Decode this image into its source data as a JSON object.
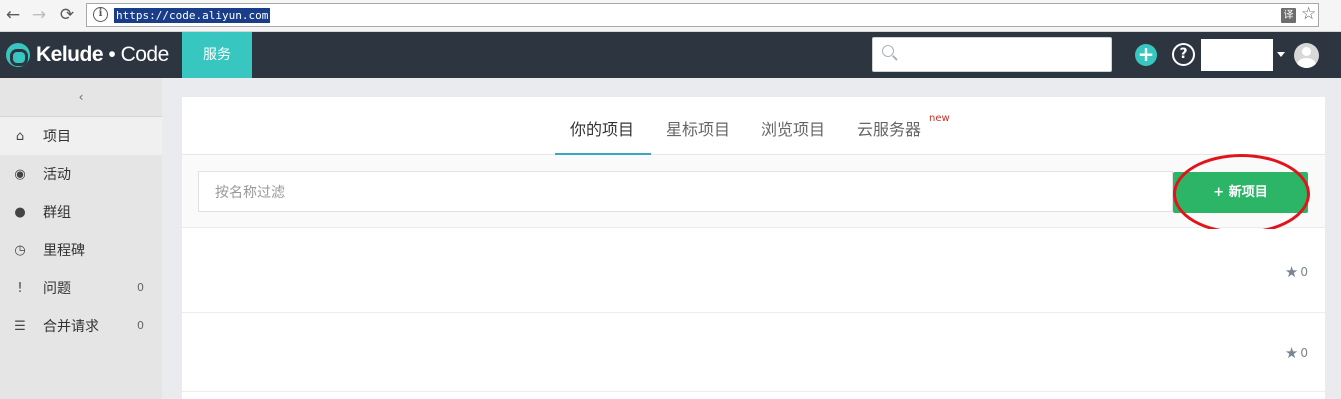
{
  "browser": {
    "back_icon": "←",
    "forward_icon": "→",
    "reload_icon": "⟳",
    "info_icon": "i",
    "url": "https://code.aliyun.com",
    "translate_icon": "译",
    "bookmark_icon": "☆"
  },
  "header": {
    "logo_name": "Kelude",
    "logo_dot": "•",
    "logo_suffix": "Code",
    "service_tab": "服务",
    "search_placeholder": "",
    "plus_icon": "+",
    "help_icon": "?"
  },
  "sidebar": {
    "collapse_icon": "‹",
    "items": [
      {
        "label": "项目",
        "icon": "⌂",
        "count": ""
      },
      {
        "label": "活动",
        "icon": "◉",
        "count": ""
      },
      {
        "label": "群组",
        "icon": "●",
        "count": ""
      },
      {
        "label": "里程碑",
        "icon": "◷",
        "count": ""
      },
      {
        "label": "问题",
        "icon": "!",
        "count": "0"
      },
      {
        "label": "合并请求",
        "icon": "☰",
        "count": "0"
      }
    ]
  },
  "main": {
    "tabs": [
      {
        "label": "你的项目"
      },
      {
        "label": "星标项目"
      },
      {
        "label": "浏览项目"
      },
      {
        "label": "云服务器"
      }
    ],
    "new_badge": "new",
    "filter_placeholder": "按名称过滤",
    "new_project_button": "+ 新项目",
    "rows": [
      {
        "stars": "0"
      },
      {
        "stars": "0"
      }
    ],
    "colors": {
      "accent": "#37c7c0",
      "header_bg": "#2c3540",
      "new_button": "#2db567",
      "annotation": "#e1141a"
    }
  }
}
